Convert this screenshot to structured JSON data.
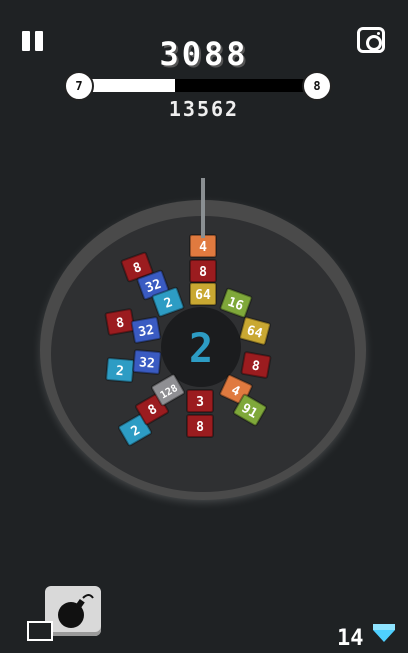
{
  "hud": {
    "score": "3088",
    "best": "13562",
    "level_current": "7",
    "level_next": "8",
    "progress": 0.4,
    "gems": "14"
  },
  "board": {
    "center_value": "2",
    "launcher_stack": [
      "4",
      "8",
      "64"
    ],
    "blocks": [
      "8",
      "32",
      "2",
      "8",
      "32",
      "2",
      "32",
      "2",
      "8",
      "128",
      "16",
      "64",
      "8",
      "4",
      "91",
      "3",
      "8",
      "2"
    ]
  },
  "colors": {
    "accent_blue": "#2d9cc4"
  }
}
